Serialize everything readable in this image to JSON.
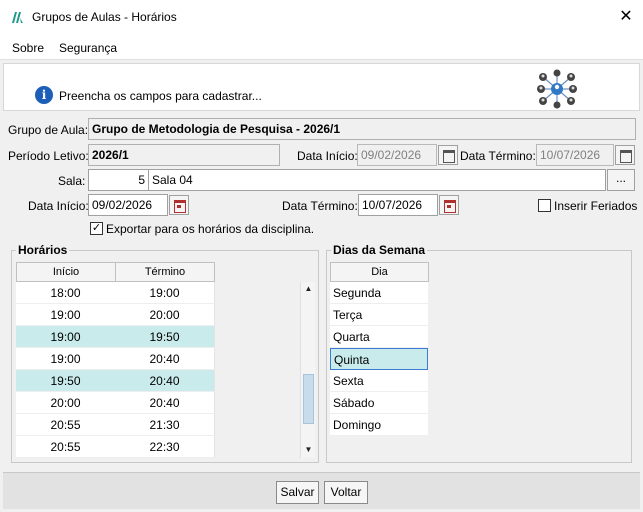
{
  "window": {
    "title": "Grupos de Aulas - Horários",
    "close_symbol": "✕"
  },
  "menu": [
    {
      "label": "Sobre"
    },
    {
      "label": "Segurança"
    }
  ],
  "info": {
    "message": "Preencha os campos para cadastrar...",
    "info_symbol": "i"
  },
  "form": {
    "grupo_label": "Grupo de Aula:",
    "grupo_value": "Grupo de Metodologia de Pesquisa - 2026/1",
    "periodo_label": "Período Letivo:",
    "periodo_value": "2026/1",
    "periodo_inicio_label": "Data Início:",
    "periodo_inicio_value": "09/02/2026",
    "periodo_termino_label": "Data Término:",
    "periodo_termino_value": "10/07/2026",
    "sala_label": "Sala:",
    "sala_code": "5",
    "sala_name": "Sala 04",
    "sala_button": "...",
    "data_inicio_label": "Data Início:",
    "data_inicio_value": "09/02/2026",
    "data_termino_label": "Data Término:",
    "data_termino_value": "10/07/2026",
    "feriados_label": "Inserir Feriados",
    "feriados_checked": false,
    "exportar_label": "Exportar para os horários da disciplina.",
    "exportar_checked": true,
    "check_symbol": "✓"
  },
  "horarios": {
    "title": "Horários",
    "columns": [
      "Início",
      "Término"
    ],
    "rows": [
      {
        "inicio": "18:00",
        "termino": "19:00",
        "selected": false
      },
      {
        "inicio": "19:00",
        "termino": "20:00",
        "selected": false
      },
      {
        "inicio": "19:00",
        "termino": "19:50",
        "selected": true
      },
      {
        "inicio": "19:00",
        "termino": "20:40",
        "selected": false
      },
      {
        "inicio": "19:50",
        "termino": "20:40",
        "selected": true
      },
      {
        "inicio": "20:00",
        "termino": "20:40",
        "selected": false
      },
      {
        "inicio": "20:55",
        "termino": "21:30",
        "selected": false
      },
      {
        "inicio": "20:55",
        "termino": "22:30",
        "selected": false
      }
    ],
    "scroll_up_symbol": "▲",
    "scroll_down_symbol": "▼"
  },
  "dias": {
    "title": "Dias da Semana",
    "column": "Dia",
    "rows": [
      {
        "dia": "Segunda",
        "selected": false
      },
      {
        "dia": "Terça",
        "selected": false
      },
      {
        "dia": "Quarta",
        "selected": false
      },
      {
        "dia": "Quinta",
        "selected": true
      },
      {
        "dia": "Sexta",
        "selected": false
      },
      {
        "dia": "Sábado",
        "selected": false
      },
      {
        "dia": "Domingo",
        "selected": false
      }
    ]
  },
  "buttons": {
    "save": "Salvar",
    "back": "Voltar"
  },
  "colors": {
    "selection": "#c9ebeb",
    "accent_blue": "#1c5fb8",
    "app_icon": "#1d9a8a"
  },
  "icons": {
    "app": "app-logo-icon",
    "info": "info-icon",
    "network": "users-network-icon",
    "calendar": "calendar-icon"
  }
}
